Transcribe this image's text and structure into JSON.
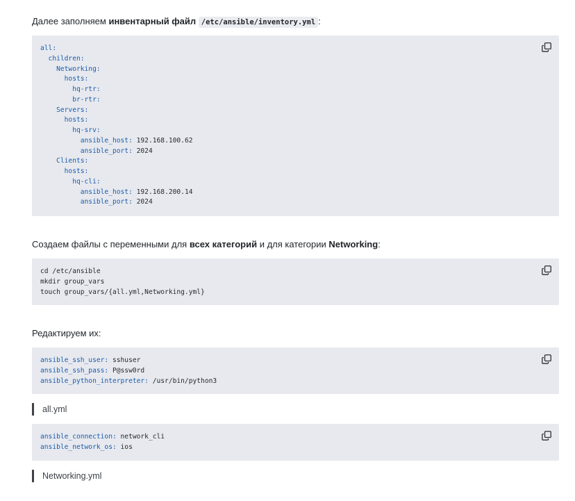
{
  "intro": {
    "prefix": "Далее заполняем ",
    "bold": "инвентарный файл",
    "code": "/etc/ansible/inventory.yml",
    "suffix": ":"
  },
  "inventory_lines": [
    {
      "key": "all:",
      "val": ""
    },
    {
      "key": "  children:",
      "val": ""
    },
    {
      "key": "    Networking:",
      "val": ""
    },
    {
      "key": "      hosts:",
      "val": ""
    },
    {
      "key": "        hq-rtr:",
      "val": ""
    },
    {
      "key": "        br-rtr:",
      "val": ""
    },
    {
      "key": "    Servers:",
      "val": ""
    },
    {
      "key": "      hosts:",
      "val": ""
    },
    {
      "key": "        hq-srv:",
      "val": ""
    },
    {
      "key": "          ansible_host:",
      "val": " 192.168.100.62"
    },
    {
      "key": "          ansible_port:",
      "val": " 2024"
    },
    {
      "key": "    Clients:",
      "val": ""
    },
    {
      "key": "      hosts:",
      "val": ""
    },
    {
      "key": "        hq-cli:",
      "val": ""
    },
    {
      "key": "          ansible_host:",
      "val": " 192.168.200.14"
    },
    {
      "key": "          ansible_port:",
      "val": " 2024"
    }
  ],
  "group_vars_intro": {
    "prefix": "Создаем файлы с переменными для ",
    "bold1": "всех категорий",
    "middle": " и для категории ",
    "bold2": "Networking",
    "suffix": ":"
  },
  "commands": [
    "cd /etc/ansible",
    "mkdir group_vars",
    "touch group_vars/{all.yml,Networking.yml}"
  ],
  "edit_intro": "Редактируем их:",
  "all_yml_lines": [
    {
      "key": "ansible_ssh_user:",
      "val": " sshuser"
    },
    {
      "key": "ansible_ssh_pass:",
      "val": " P@ssw0rd"
    },
    {
      "key": "ansible_python_interpreter:",
      "val": " /usr/bin/python3"
    }
  ],
  "all_yml_caption": "all.yml",
  "networking_yml_lines": [
    {
      "key": "ansible_connection:",
      "val": " network_cli"
    },
    {
      "key": "ansible_network_os:",
      "val": " ios"
    }
  ],
  "networking_yml_caption": "Networking.yml",
  "icons": {
    "copy": "copy-icon"
  }
}
